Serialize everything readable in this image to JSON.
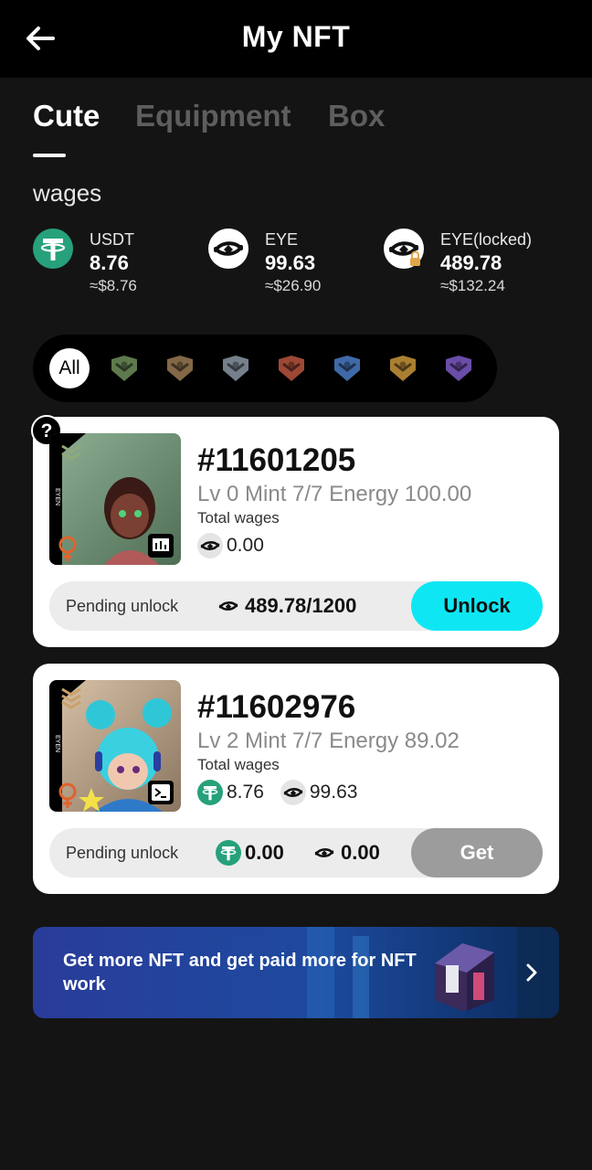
{
  "header": {
    "title": "My NFT",
    "back_icon": "arrow-left-icon"
  },
  "tabs": [
    {
      "label": "Cute",
      "active": true
    },
    {
      "label": "Equipment",
      "active": false
    },
    {
      "label": "Box",
      "active": false
    }
  ],
  "wages": {
    "title": "wages",
    "items": [
      {
        "name": "USDT",
        "amount": "8.76",
        "usd": "≈$8.76",
        "icon": "tether-icon"
      },
      {
        "name": "EYE",
        "amount": "99.63",
        "usd": "≈$26.90",
        "icon": "eye-token-icon"
      },
      {
        "name": "EYE(locked)",
        "amount": "489.78",
        "usd": "≈$132.24",
        "icon": "eye-locked-icon"
      }
    ]
  },
  "filter": {
    "all_label": "All",
    "ranks": [
      "rank-1-icon",
      "rank-2-icon",
      "rank-3-icon",
      "rank-4-icon",
      "rank-5-icon",
      "rank-6-icon",
      "rank-7-icon"
    ]
  },
  "nfts": [
    {
      "id": "#11601205",
      "stats": "Lv 0 Mint 7/7 Energy 100.00",
      "total_wages_label": "Total wages",
      "wages": [
        {
          "icon": "eye-token-icon",
          "value": "0.00"
        }
      ],
      "pending_label": "Pending unlock",
      "pending": [
        {
          "icon": "eye-token-icon",
          "value": "489.78/1200"
        }
      ],
      "action": "Unlock"
    },
    {
      "id": "#11602976",
      "stats": "Lv 2 Mint 7/7 Energy 89.02",
      "total_wages_label": "Total wages",
      "wages": [
        {
          "icon": "tether-icon",
          "value": "8.76"
        },
        {
          "icon": "eye-token-icon",
          "value": "99.63"
        }
      ],
      "pending_label": "Pending unlock",
      "pending": [
        {
          "icon": "tether-icon",
          "value": "0.00"
        },
        {
          "icon": "eye-token-icon",
          "value": "0.00"
        }
      ],
      "action": "Get"
    }
  ],
  "banner": {
    "text": "Get more NFT and get paid more for NFT work"
  },
  "colors": {
    "accent": "#0ee7f3",
    "tether": "#26a17b",
    "background": "#141414"
  }
}
